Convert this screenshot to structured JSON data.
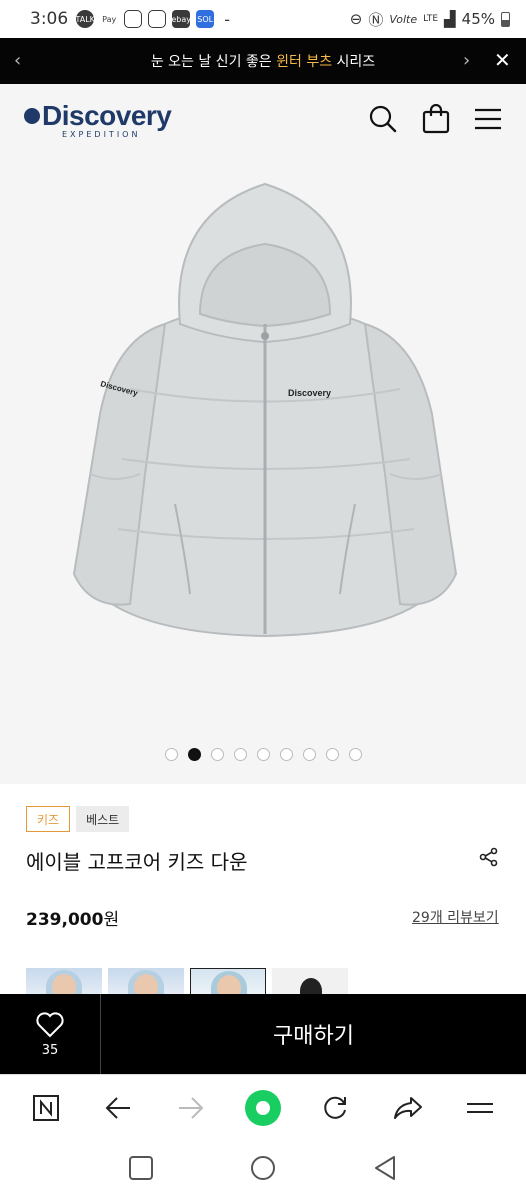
{
  "status_bar": {
    "time": "3:06",
    "notification_labels": [
      "TALK",
      "Pay",
      "ebay"
    ],
    "battery": "45%",
    "network": "LTE",
    "dash": "-"
  },
  "promo_banner": {
    "text_before": "눈 오는 날 신기 좋은 ",
    "highlight": "윈터 부츠",
    "text_after": " 시리즈",
    "prev_icon": "‹",
    "next_icon": "›",
    "close_icon": "✕"
  },
  "header": {
    "logo_main": "Discovery",
    "logo_sub": "EXPEDITION",
    "icons": [
      "search-icon",
      "bag-icon",
      "menu-icon"
    ]
  },
  "hero": {
    "jacket_logo": "Discovery",
    "sleeve_logo": "Discovery",
    "carousel_total": 9,
    "carousel_active_index": 1
  },
  "product": {
    "tags": [
      "키즈",
      "베스트"
    ],
    "title": "에이블 고프코어 키즈 다운",
    "price_number": "239,000",
    "price_unit": "원",
    "review_link": "29개 리뷰보기"
  },
  "buy_bar": {
    "like_count": "35",
    "buy_label": "구매하기"
  },
  "browser_toolbar": {
    "items": [
      "naver-icon",
      "back-arrow-icon",
      "forward-arrow-icon",
      "home-circle-icon",
      "refresh-icon",
      "share-arrow-icon",
      "menu-icon"
    ]
  },
  "colors": {
    "accent_orange": "#e49a3a",
    "promo_highlight": "#f5b945",
    "brand_navy": "#1f3a68",
    "home_green": "#19ce60"
  }
}
